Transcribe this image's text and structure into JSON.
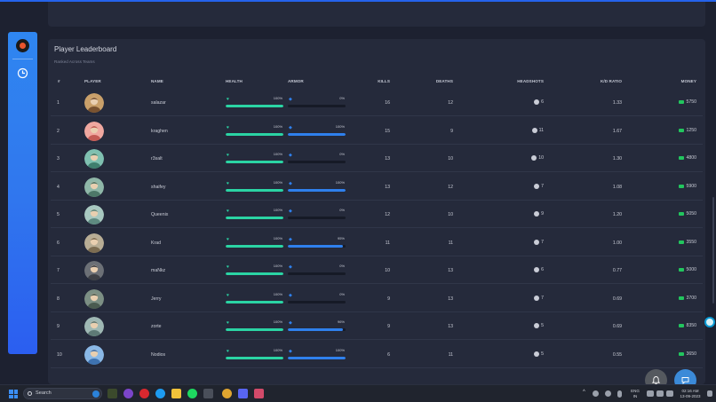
{
  "board": {
    "title": "Player Leaderboard",
    "subtitle": "Ranked Across Teams",
    "columns": {
      "rank": "#",
      "player": "PLAYER",
      "name": "NAME",
      "health": "HEALTH",
      "armor": "ARMOR",
      "kills": "KILLS",
      "deaths": "DEATHS",
      "headshots": "HEADSHOTS",
      "kd": "K/D RATIO",
      "money": "MONEY"
    },
    "rows": [
      {
        "rank": "1",
        "name": "salazar",
        "health": "100%",
        "health_val": 100,
        "armor": "0%",
        "armor_val": 0,
        "kills": "16",
        "deaths": "12",
        "headshots": "6",
        "kd": "1.33",
        "money": "5750"
      },
      {
        "rank": "2",
        "name": "kraghen",
        "health": "100%",
        "health_val": 100,
        "armor": "100%",
        "armor_val": 100,
        "kills": "15",
        "deaths": "9",
        "headshots": "11",
        "kd": "1.67",
        "money": "1250"
      },
      {
        "rank": "3",
        "name": "r3salt",
        "health": "100%",
        "health_val": 100,
        "armor": "0%",
        "armor_val": 0,
        "kills": "13",
        "deaths": "10",
        "headshots": "10",
        "kd": "1.30",
        "money": "4800"
      },
      {
        "rank": "4",
        "name": "shaifey",
        "health": "100%",
        "health_val": 100,
        "armor": "100%",
        "armor_val": 100,
        "kills": "13",
        "deaths": "12",
        "headshots": "7",
        "kd": "1.08",
        "money": "5900"
      },
      {
        "rank": "5",
        "name": "Queenix",
        "health": "100%",
        "health_val": 100,
        "armor": "0%",
        "armor_val": 0,
        "kills": "12",
        "deaths": "10",
        "headshots": "9",
        "kd": "1.20",
        "money": "5050"
      },
      {
        "rank": "6",
        "name": "Krad",
        "health": "100%",
        "health_val": 100,
        "armor": "95%",
        "armor_val": 95,
        "kills": "11",
        "deaths": "11",
        "headshots": "7",
        "kd": "1.00",
        "money": "3550"
      },
      {
        "rank": "7",
        "name": "maNkz",
        "health": "100%",
        "health_val": 100,
        "armor": "0%",
        "armor_val": 0,
        "kills": "10",
        "deaths": "13",
        "headshots": "6",
        "kd": "0.77",
        "money": "5000"
      },
      {
        "rank": "8",
        "name": "Jerry",
        "health": "100%",
        "health_val": 100,
        "armor": "0%",
        "armor_val": 0,
        "kills": "9",
        "deaths": "13",
        "headshots": "7",
        "kd": "0.69",
        "money": "3700"
      },
      {
        "rank": "9",
        "name": "zorte",
        "health": "100%",
        "health_val": 100,
        "armor": "96%",
        "armor_val": 96,
        "kills": "9",
        "deaths": "13",
        "headshots": "5",
        "kd": "0.69",
        "money": "8350"
      },
      {
        "rank": "10",
        "name": "Nodios",
        "health": "100%",
        "health_val": 100,
        "armor": "100%",
        "armor_val": 100,
        "kills": "6",
        "deaths": "11",
        "headshots": "5",
        "kd": "0.55",
        "money": "3650"
      }
    ]
  },
  "colors": {
    "health": "#2bd4a4",
    "armor": "#2f80ed",
    "accent": "#2f7cf0",
    "money": "#22c55e"
  },
  "icons": {
    "sidebar_logo": "dota-logo-icon",
    "sidebar_nav": "clock-icon",
    "health": "heart-icon",
    "armor": "shield-icon",
    "headshots": "skull-icon",
    "money": "cash-icon",
    "fab_bell": "bell-icon",
    "fab_chat": "chat-icon"
  },
  "taskbar": {
    "search_placeholder": "Search",
    "lang_top": "ENG",
    "lang_bottom": "IN",
    "time": "02:16 AM",
    "date": "13-09-2023"
  }
}
